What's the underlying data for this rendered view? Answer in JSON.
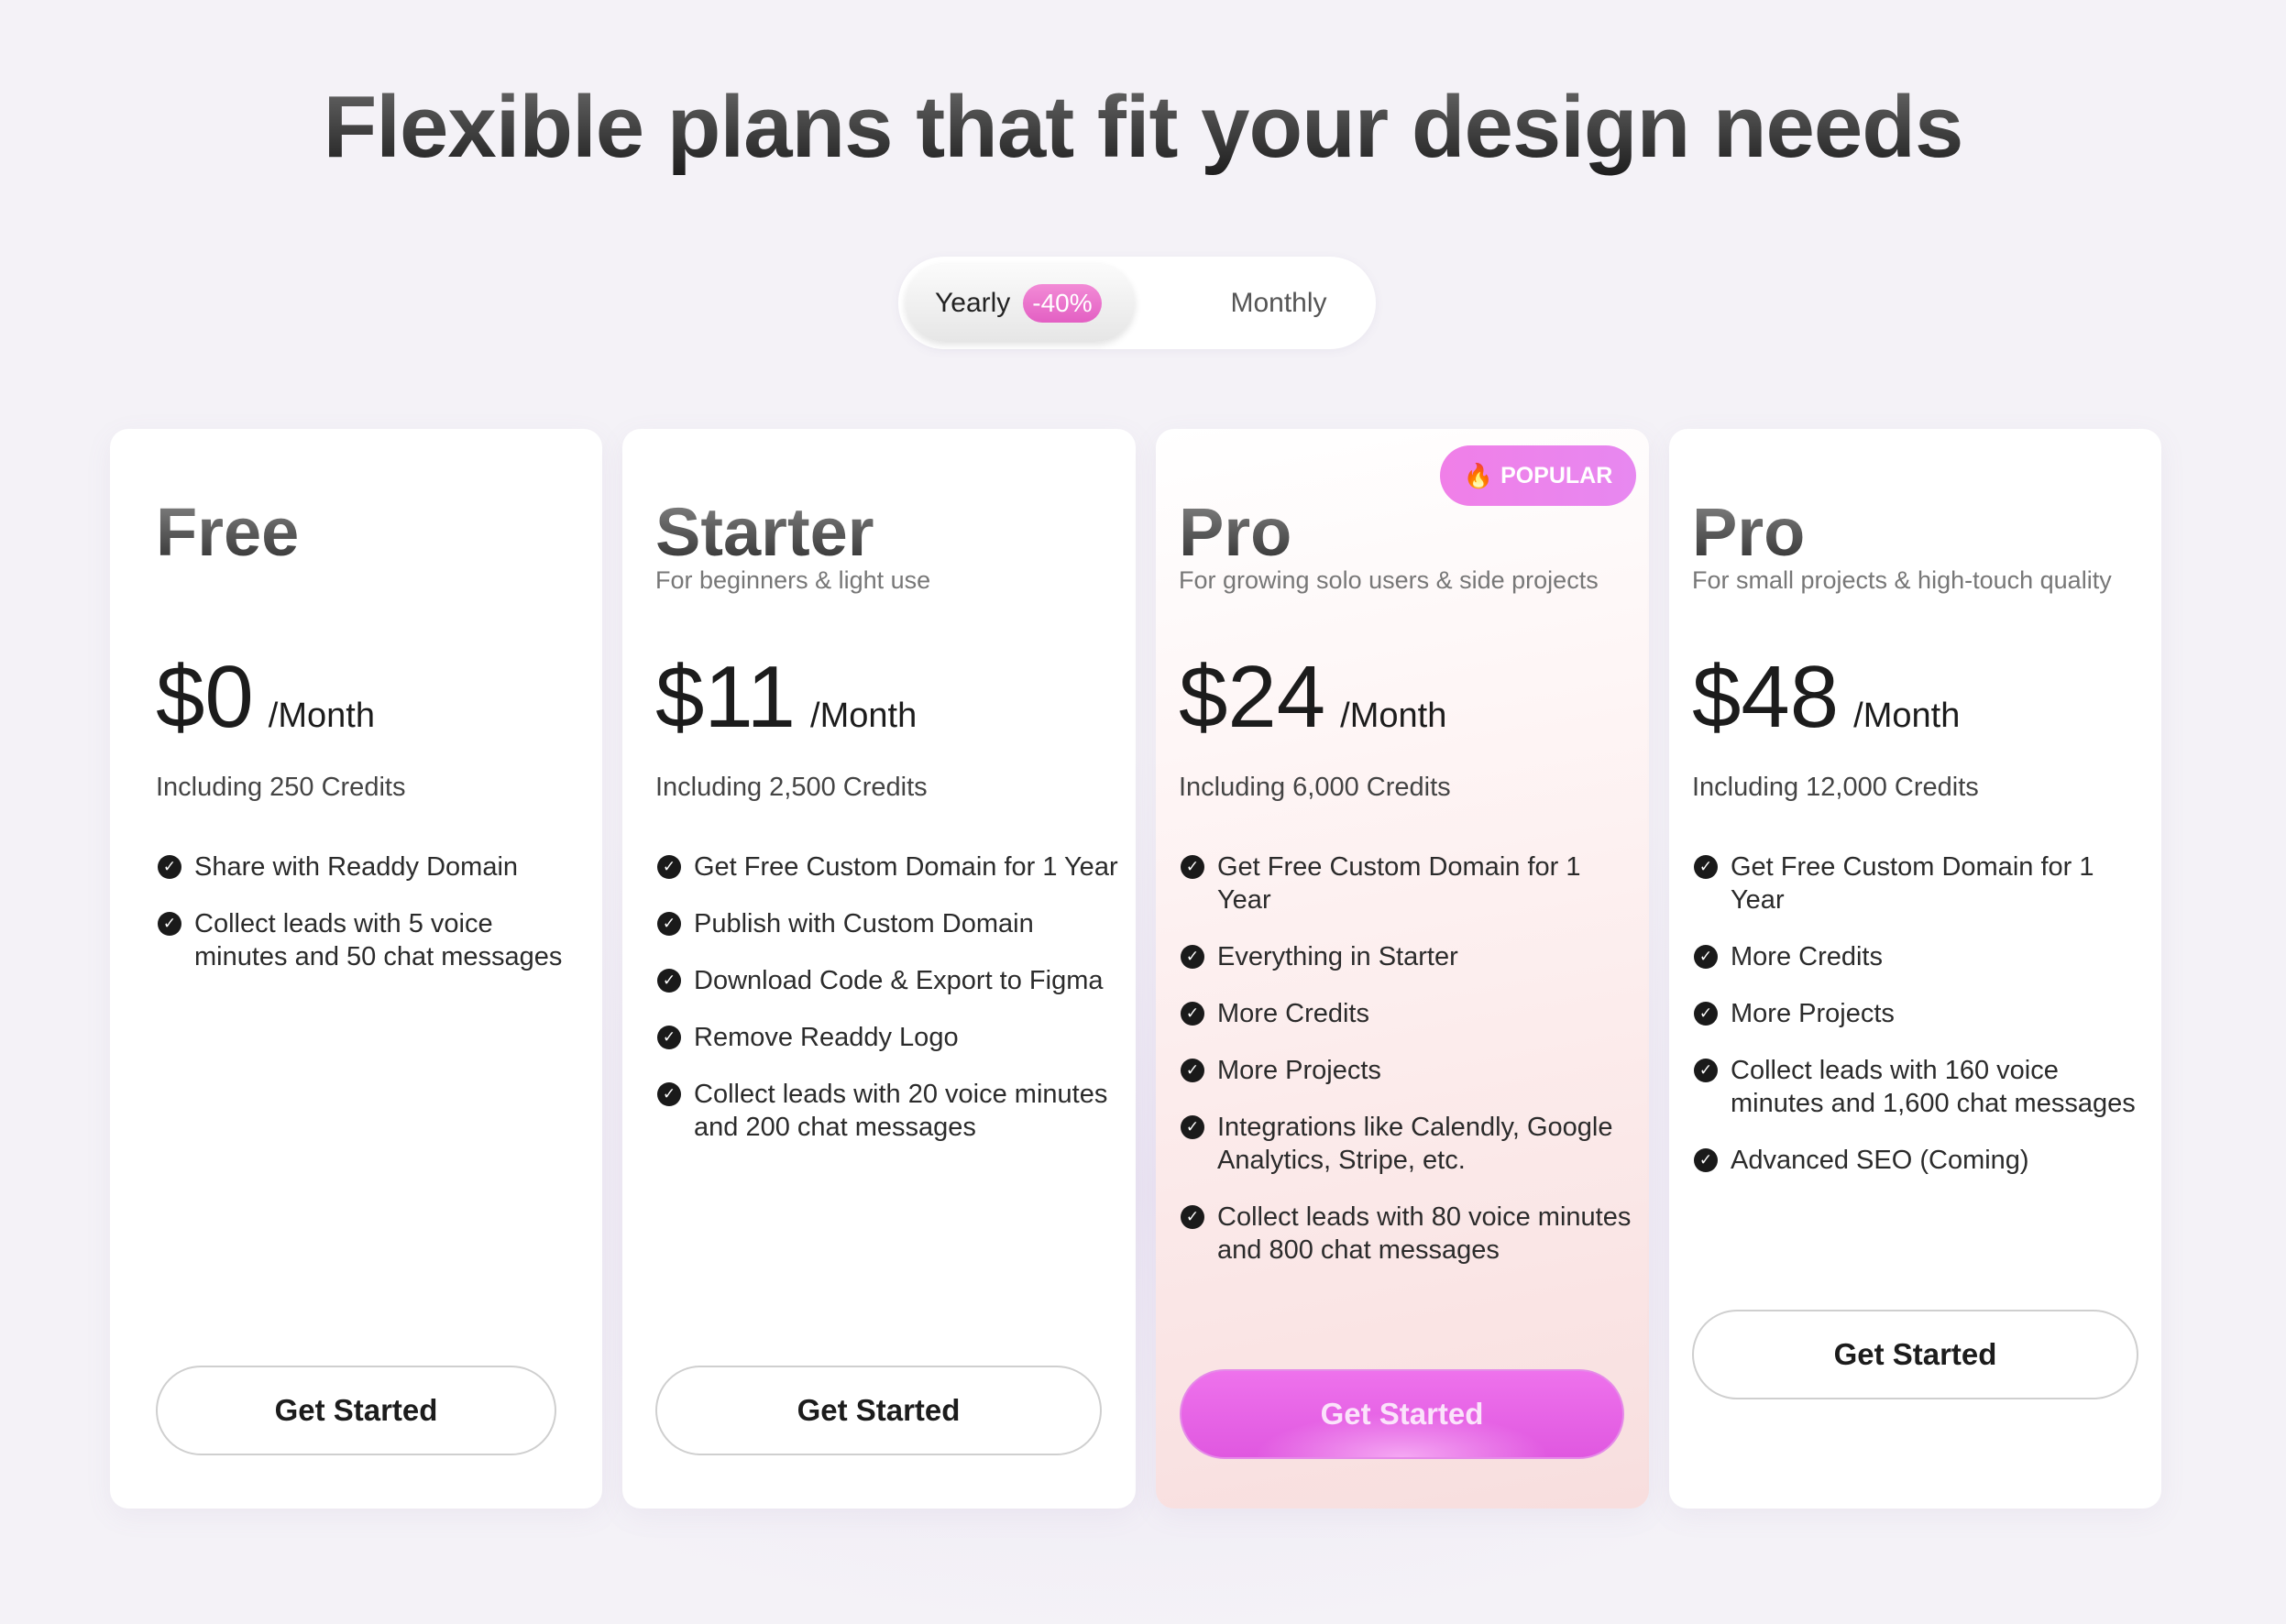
{
  "headline": "Flexible plans that fit your design needs",
  "toggle": {
    "yearly_label": "Yearly",
    "discount_badge": "-40%",
    "monthly_label": "Monthly",
    "selected": "Yearly"
  },
  "popular_badge": {
    "icon": "flame-icon",
    "label": "POPULAR"
  },
  "plans": [
    {
      "name": "Free",
      "subtitle": "",
      "price": "$0",
      "period": "/Month",
      "credits": "Including 250 Credits",
      "features": [
        "Share with Readdy Domain",
        "Collect leads with 5 voice minutes and 50 chat messages"
      ],
      "cta": "Get Started"
    },
    {
      "name": "Starter",
      "subtitle": "For beginners & light use",
      "price": "$11",
      "period": "/Month",
      "credits": "Including 2,500 Credits",
      "features": [
        "Get Free Custom Domain for 1 Year",
        "Publish with Custom Domain",
        "Download Code & Export to Figma",
        "Remove Readdy Logo",
        "Collect leads with 20 voice minutes and 200 chat messages"
      ],
      "cta": "Get Started"
    },
    {
      "name": "Pro",
      "subtitle": "For growing solo users & side projects",
      "price": "$24",
      "period": "/Month",
      "credits": "Including 6,000 Credits",
      "features": [
        "Get Free Custom Domain for 1 Year",
        "Everything in Starter",
        "More Credits",
        "More Projects",
        "Integrations like Calendly, Google Analytics, Stripe, etc.",
        "Collect leads with 80 voice minutes and 800 chat messages"
      ],
      "cta": "Get Started"
    },
    {
      "name": "Pro",
      "subtitle": "For small projects & high-touch quality",
      "price": "$48",
      "period": "/Month",
      "credits": "Including 12,000 Credits",
      "features": [
        "Get Free Custom Domain for 1 Year",
        "More Credits",
        "More Projects",
        "Collect leads with 160 voice minutes and 1,600 chat messages",
        "Advanced SEO (Coming)"
      ],
      "cta": "Get Started"
    }
  ],
  "colors": {
    "accent_pink": "#e35fc3",
    "cta_pink": "#e058e0",
    "background": "#f4f2f7"
  }
}
